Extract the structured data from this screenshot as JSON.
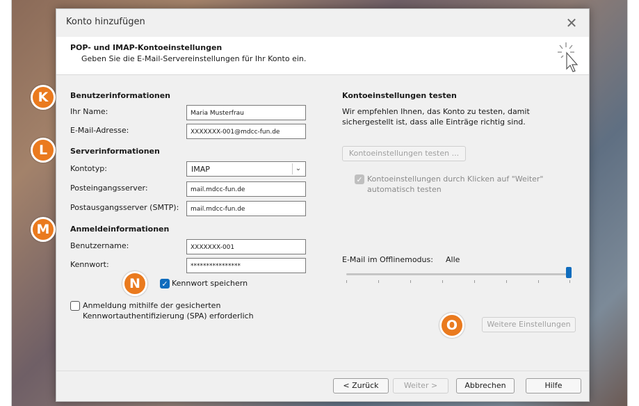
{
  "dialog": {
    "title": "Konto hinzufügen",
    "close_glyph": "✕",
    "header_title": "POP- und IMAP-Kontoeinstellungen",
    "header_subtitle": "Geben Sie die E-Mail-Servereinstellungen für Ihr Konto ein."
  },
  "user_info": {
    "heading": "Benutzerinformationen",
    "name_label": "Ihr Name:",
    "name_value": "Maria Musterfrau",
    "email_label": "E-Mail-Adresse:",
    "email_value": "XXXXXXX-001@mdcc-fun.de"
  },
  "server_info": {
    "heading": "Serverinformationen",
    "account_type_label": "Kontotyp:",
    "account_type_value": "IMAP",
    "incoming_label": "Posteingangsserver:",
    "incoming_value": "mail.mdcc-fun.de",
    "outgoing_label": "Postausgangsserver (SMTP):",
    "outgoing_value": "mail.mdcc-fun.de"
  },
  "login_info": {
    "heading": "Anmeldeinformationen",
    "username_label": "Benutzername:",
    "username_value": "XXXXXXX-001",
    "password_label": "Kennwort:",
    "password_value": "****************",
    "remember_label": "Kennwort speichern",
    "remember_checked": true,
    "spa_label_line1": "Anmeldung mithilfe der gesicherten",
    "spa_label_line2": "Kennwortauthentifizierung (SPA) erforderlich",
    "spa_checked": false
  },
  "test": {
    "heading": "Kontoeinstellungen testen",
    "description_line1": "Wir empfehlen Ihnen, das Konto zu testen, damit",
    "description_line2": "sichergestellt ist, dass alle Einträge richtig sind.",
    "test_button": "Kontoeinstellungen testen ...",
    "auto_test_line1": "Kontoeinstellungen durch Klicken auf \"Weiter\"",
    "auto_test_line2": "automatisch testen"
  },
  "offline": {
    "label": "E-Mail im Offlinemodus:",
    "value": "Alle",
    "slider_position_fraction": 1.0
  },
  "more_settings_button": "Weitere Einstellungen",
  "footer": {
    "back": "< Zurück",
    "next": "Weiter >",
    "cancel": "Abbrechen",
    "help": "Hilfe"
  },
  "annotations": [
    "K",
    "L",
    "M",
    "N",
    "O"
  ],
  "colors": {
    "badge": "#ea7a1e",
    "accent": "#0f6cbd",
    "dialog_bg": "#f0f0f0"
  }
}
